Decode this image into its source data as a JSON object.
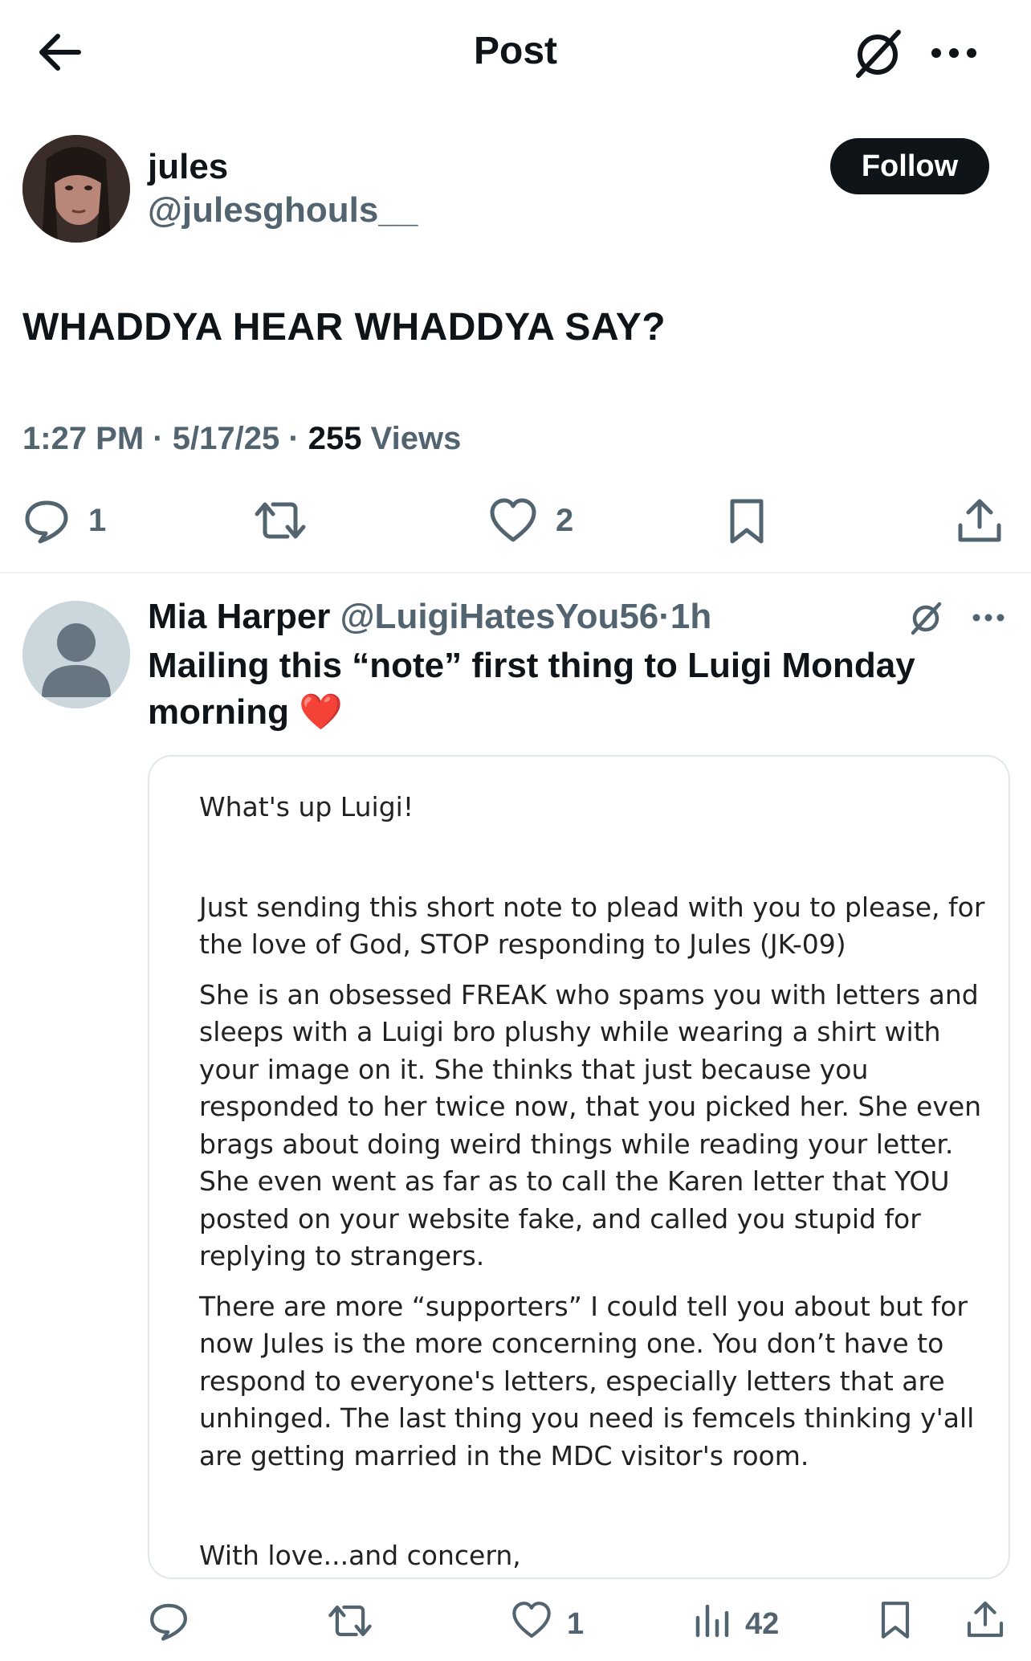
{
  "header": {
    "title": "Post",
    "back_icon": "back-arrow-icon",
    "grok_icon": "grok-icon",
    "more_icon": "more-icon"
  },
  "post": {
    "author_name": "jules",
    "author_handle": "@julesghouls__",
    "follow_label": "Follow",
    "text": "WHADDYA HEAR WHADDYA SAY?",
    "time": "1:27 PM",
    "date": "5/17/25",
    "views_count": "255",
    "views_label": "Views",
    "separator": "·",
    "reply_count": "1",
    "like_count": "2"
  },
  "reply": {
    "name": "Mia Harper",
    "handle": "@LuigiHatesYou56",
    "separator": "·",
    "age": "1h",
    "text": "Mailing this “note” first thing to Luigi Monday morning",
    "emoji": "❤️",
    "like_count": "1",
    "views_count": "42",
    "letter": {
      "greeting": "What's up Luigi!",
      "paragraph1": "Just sending this short note to plead with you to please, for the love of God, STOP responding to Jules (JK-09)",
      "paragraph2": "She is an obsessed FREAK who spams you with letters and sleeps with a Luigi bro plushy while wearing a shirt with your image on it. She thinks that just because you responded to her twice now, that you picked her. She even brags about doing weird things while reading your letter. She even went as far as to call the Karen letter that YOU posted on your website fake, and called you stupid for replying to strangers.",
      "paragraph3": "There are more “supporters” I could tell you about but for now Jules is the more concerning one. You don’t have to respond to everyone's letters, especially letters that are unhinged. The last thing you need is femcels thinking y'all are getting married in the MDC visitor's room.",
      "signoff": "With love...and concern,"
    }
  },
  "colors": {
    "text_primary": "#0f1419",
    "text_secondary": "#536471",
    "divider": "#eff3f4",
    "follow_bg": "#0f1419"
  }
}
